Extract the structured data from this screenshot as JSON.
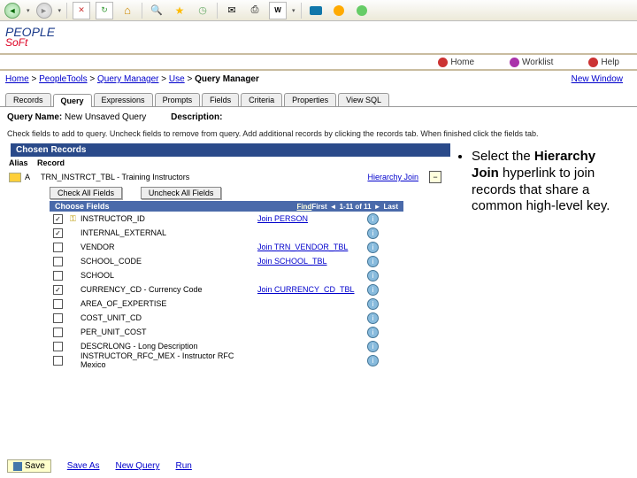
{
  "toolbar": {
    "back": "◄",
    "fwd": "►",
    "stop": "✕",
    "refresh": "↻"
  },
  "nav": {
    "home": "Home",
    "worklist": "Worklist",
    "help": "Help"
  },
  "breadcrumb": {
    "home": "Home",
    "pt": "PeopleTools",
    "qm": "Query Manager",
    "use": "Use",
    "cur": "Query Manager"
  },
  "newwindow": "New Window",
  "tabs": [
    "Records",
    "Query",
    "Expressions",
    "Prompts",
    "Fields",
    "Criteria",
    "Properties",
    "View SQL"
  ],
  "query": {
    "namelabel": "Query Name:",
    "name": "New Unsaved Query",
    "desclabel": "Description:"
  },
  "instruction": "Check fields to add to query. Uncheck fields to remove from query. Add additional records by clicking the records tab. When finished click the fields tab.",
  "chosen": "Chosen Records",
  "headers": {
    "alias": "Alias",
    "record": "Record"
  },
  "record": {
    "alias": "A",
    "name": "TRN_INSTRCT_TBL - Training Instructors",
    "hier": "Hierarchy Join",
    "minus": "−"
  },
  "btns": {
    "checkall": "Check All Fields",
    "uncheckall": "Uncheck All Fields"
  },
  "choose": {
    "title": "Choose Fields",
    "find": "Find",
    "first": "First",
    "range": "1-11 of 11",
    "last": "Last"
  },
  "fields": [
    {
      "chk": true,
      "key": true,
      "name": "INSTRUCTOR_ID",
      "join": "Join PERSON"
    },
    {
      "chk": true,
      "key": false,
      "name": "INTERNAL_EXTERNAL",
      "join": ""
    },
    {
      "chk": false,
      "key": false,
      "name": "VENDOR",
      "join": "Join TRN_VENDOR_TBL"
    },
    {
      "chk": false,
      "key": false,
      "name": "SCHOOL_CODE",
      "join": "Join SCHOOL_TBL"
    },
    {
      "chk": false,
      "key": false,
      "name": "SCHOOL",
      "join": ""
    },
    {
      "chk": true,
      "key": false,
      "name": "CURRENCY_CD - Currency Code",
      "join": "Join CURRENCY_CD_TBL"
    },
    {
      "chk": false,
      "key": false,
      "name": "AREA_OF_EXPERTISE",
      "join": ""
    },
    {
      "chk": false,
      "key": false,
      "name": "COST_UNIT_CD",
      "join": ""
    },
    {
      "chk": false,
      "key": false,
      "name": "PER_UNIT_COST",
      "join": ""
    },
    {
      "chk": false,
      "key": false,
      "name": "DESCRLONG - Long Description",
      "join": ""
    },
    {
      "chk": false,
      "key": false,
      "name": "INSTRUCTOR_RFC_MEX - Instructor RFC Mexico",
      "join": ""
    }
  ],
  "actions": {
    "save": "Save",
    "saveas": "Save As",
    "newq": "New Query",
    "run": "Run"
  },
  "annotation": {
    "text_a": "Select the ",
    "text_b": "Hierarchy Join",
    "text_c": " hyperlink to join records that share a common high-level key."
  }
}
